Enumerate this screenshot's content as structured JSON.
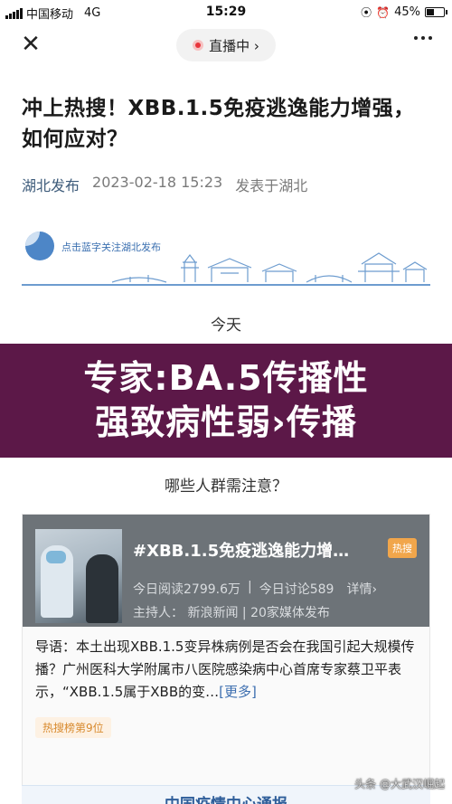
{
  "status_bar": {
    "carrier": "中国移动",
    "network": "4G",
    "time": "15:29",
    "battery_percent": "45%",
    "battery_level": 0.45
  },
  "nav": {
    "live_label": "直播中 ›"
  },
  "article": {
    "title": "冲上热搜！XBB.1.5免疫逃逸能力增强，如何应对？",
    "author": "湖北发布",
    "datetime": "2023-02-18 15:23",
    "location": "发表于湖北"
  },
  "banner": {
    "text": "点击蓝字关注湖北发布"
  },
  "content": {
    "today": "今天",
    "overlay_line1": "专家:BA.5传播性",
    "overlay_line2": "强致病性弱›传播",
    "question": "哪些人群需注意？"
  },
  "topic_card": {
    "title": "#XBB.1.5免疫逃逸能力增…",
    "badge": "热搜",
    "reads": "今日阅读2799.6万",
    "discussions": "今日讨论589",
    "details": "详情›",
    "host": "主持人：  新浪新闻 | 20家媒体发布",
    "intro": "导语：本土出现XBB.1.5变异株病例是否会在我国引起大规模传播？广州医科大学附属市八医院感染病中心首席专家蔡卫平表示，“XBB.1.5属于XBB的变…",
    "more": "[更多]",
    "rank": "热搜榜第9位"
  },
  "bottom": {
    "banner_text": "中国疫情中心通报",
    "watermark": "头条 @大武汉崛起"
  },
  "colors": {
    "overlay": "#5c1848",
    "accent_blue": "#3d6fb0",
    "hot_orange": "#f1a64b",
    "live_red": "#e8343b"
  },
  "icons": [
    "close-icon",
    "live-dot-icon",
    "more-dots-icon",
    "signal-icon",
    "alarm-icon",
    "battery-icon"
  ]
}
